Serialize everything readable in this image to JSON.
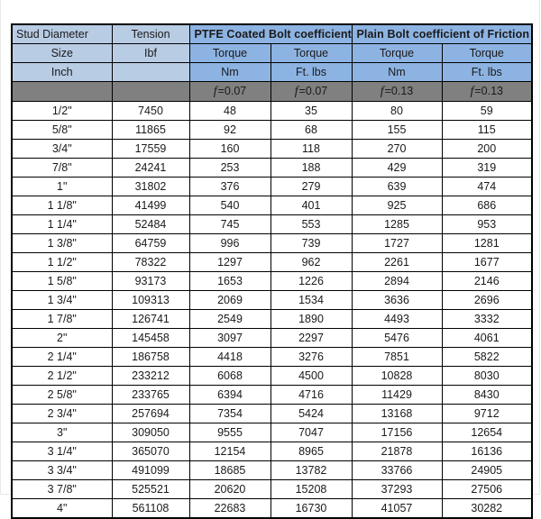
{
  "table": {
    "group_headers": {
      "stud_diameter": "Stud Diameter",
      "tension": "Tension",
      "ptfe_group": "PTFE Coated Bolt coefficient of Friction",
      "plain_group": "Plain Bolt coefficient of Friction"
    },
    "row2": {
      "size": "Size",
      "lbf": "Ibf",
      "torque1": "Torque",
      "torque2": "Torque",
      "torque3": "Torque",
      "torque4": "Torque"
    },
    "row3": {
      "inch": "Inch",
      "blank": "",
      "nm1": "Nm",
      "ftlbs1": "Ft. lbs",
      "nm2": "Nm",
      "ftlbs2": "Ft. lbs"
    },
    "row4": {
      "blank1": "",
      "blank2": "",
      "f1_symbol": "f",
      "f1_value": "=0.07",
      "f2_symbol": "f",
      "f2_value": "=0.07",
      "f3_symbol": "f",
      "f3_value": "=0.13",
      "f4_symbol": "f",
      "f4_value": "=0.13"
    },
    "colors": {
      "header_light_blue": "#b8cce4",
      "header_dark_blue": "#8db3e2",
      "header_gray": "#808080",
      "border": "#000000",
      "page_background": "#ffffff"
    },
    "columns": [
      "Size",
      "Tension (Ibf)",
      "PTFE Nm",
      "PTFE Ft. lbs",
      "Plain Nm",
      "Plain Ft. lbs"
    ],
    "rows": [
      {
        "size": "1/2\"",
        "tension": "7450",
        "ptfe_nm": "48",
        "ptfe_ftlbs": "35",
        "plain_nm": "80",
        "plain_ftlbs": "59"
      },
      {
        "size": "5/8\"",
        "tension": "11865",
        "ptfe_nm": "92",
        "ptfe_ftlbs": "68",
        "plain_nm": "155",
        "plain_ftlbs": "115"
      },
      {
        "size": "3/4\"",
        "tension": "17559",
        "ptfe_nm": "160",
        "ptfe_ftlbs": "118",
        "plain_nm": "270",
        "plain_ftlbs": "200"
      },
      {
        "size": "7/8\"",
        "tension": "24241",
        "ptfe_nm": "253",
        "ptfe_ftlbs": "188",
        "plain_nm": "429",
        "plain_ftlbs": "319"
      },
      {
        "size": "1\"",
        "tension": "31802",
        "ptfe_nm": "376",
        "ptfe_ftlbs": "279",
        "plain_nm": "639",
        "plain_ftlbs": "474"
      },
      {
        "size": "1  1/8\"",
        "tension": "41499",
        "ptfe_nm": "540",
        "ptfe_ftlbs": "401",
        "plain_nm": "925",
        "plain_ftlbs": "686"
      },
      {
        "size": "1  1/4\"",
        "tension": "52484",
        "ptfe_nm": "745",
        "ptfe_ftlbs": "553",
        "plain_nm": "1285",
        "plain_ftlbs": "953"
      },
      {
        "size": "1  3/8\"",
        "tension": "64759",
        "ptfe_nm": "996",
        "ptfe_ftlbs": "739",
        "plain_nm": "1727",
        "plain_ftlbs": "1281"
      },
      {
        "size": "1  1/2\"",
        "tension": "78322",
        "ptfe_nm": "1297",
        "ptfe_ftlbs": "962",
        "plain_nm": "2261",
        "plain_ftlbs": "1677"
      },
      {
        "size": "1  5/8\"",
        "tension": "93173",
        "ptfe_nm": "1653",
        "ptfe_ftlbs": "1226",
        "plain_nm": "2894",
        "plain_ftlbs": "2146"
      },
      {
        "size": "1  3/4\"",
        "tension": "109313",
        "ptfe_nm": "2069",
        "ptfe_ftlbs": "1534",
        "plain_nm": "3636",
        "plain_ftlbs": "2696"
      },
      {
        "size": "1  7/8\"",
        "tension": "126741",
        "ptfe_nm": "2549",
        "ptfe_ftlbs": "1890",
        "plain_nm": "4493",
        "plain_ftlbs": "3332"
      },
      {
        "size": "2\"",
        "tension": "145458",
        "ptfe_nm": "3097",
        "ptfe_ftlbs": "2297",
        "plain_nm": "5476",
        "plain_ftlbs": "4061"
      },
      {
        "size": "2  1/4\"",
        "tension": "186758",
        "ptfe_nm": "4418",
        "ptfe_ftlbs": "3276",
        "plain_nm": "7851",
        "plain_ftlbs": "5822"
      },
      {
        "size": "2  1/2\"",
        "tension": "233212",
        "ptfe_nm": "6068",
        "ptfe_ftlbs": "4500",
        "plain_nm": "10828",
        "plain_ftlbs": "8030"
      },
      {
        "size": "2   5/8\"",
        "tension": "233765",
        "ptfe_nm": "6394",
        "ptfe_ftlbs": "4716",
        "plain_nm": "11429",
        "plain_ftlbs": "8430"
      },
      {
        "size": "2    3/4\"",
        "tension": "257694",
        "ptfe_nm": "7354",
        "ptfe_ftlbs": "5424",
        "plain_nm": "13168",
        "plain_ftlbs": "9712"
      },
      {
        "size": "3\"",
        "tension": "309050",
        "ptfe_nm": "9555",
        "ptfe_ftlbs": "7047",
        "plain_nm": "17156",
        "plain_ftlbs": "12654"
      },
      {
        "size": "3   1/4\"",
        "tension": "365070",
        "ptfe_nm": "12154",
        "ptfe_ftlbs": "8965",
        "plain_nm": "21878",
        "plain_ftlbs": "16136"
      },
      {
        "size": "3   3/4\"",
        "tension": "491099",
        "ptfe_nm": "18685",
        "ptfe_ftlbs": "13782",
        "plain_nm": "33766",
        "plain_ftlbs": "24905"
      },
      {
        "size": "3  7/8\"",
        "tension": "525521",
        "ptfe_nm": "20620",
        "ptfe_ftlbs": "15208",
        "plain_nm": "37293",
        "plain_ftlbs": "27506"
      },
      {
        "size": "4\"",
        "tension": "561108",
        "ptfe_nm": "22683",
        "ptfe_ftlbs": "16730",
        "plain_nm": "41057",
        "plain_ftlbs": "30282"
      }
    ]
  }
}
